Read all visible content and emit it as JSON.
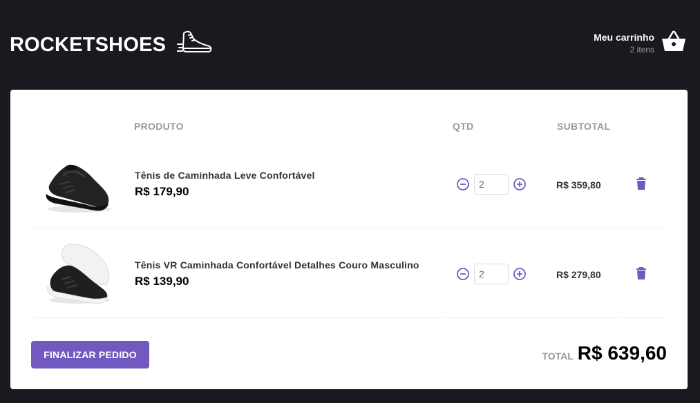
{
  "header": {
    "logo": "ROCKETSHOES",
    "logo_icon": "sneaker-icon",
    "cart_title": "Meu carrinho",
    "cart_count": "2 itens",
    "cart_icon": "basket-icon"
  },
  "table": {
    "col_product": "PRODUTO",
    "col_qty": "QTD",
    "col_subtotal": "SUBTOTAL"
  },
  "items": [
    {
      "title": "Tênis de Caminhada Leve Confortável",
      "price": "R$ 179,90",
      "qty": "2",
      "subtotal": "R$ 359,80"
    },
    {
      "title": "Tênis VR Caminhada Confortável Detalhes Couro Masculino",
      "price": "R$ 139,90",
      "qty": "2",
      "subtotal": "R$ 279,80"
    }
  ],
  "footer": {
    "checkout_label": "FINALIZAR PEDIDO",
    "total_label": "TOTAL",
    "total_value": "R$ 639,60"
  },
  "colors": {
    "brand": "#7159c1",
    "background": "#191920"
  }
}
